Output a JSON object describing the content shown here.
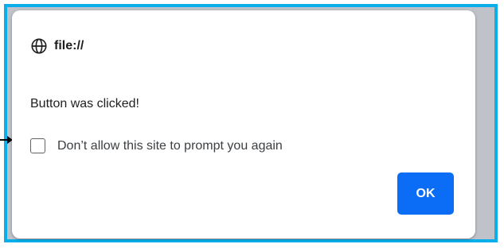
{
  "dialog": {
    "origin": "file://",
    "origin_icon": "globe-icon",
    "message": "Button was clicked!",
    "suppress_label": "Don’t allow this site to prompt you again",
    "suppress_checked": false,
    "ok_label": "OK"
  },
  "colors": {
    "frame_border": "#0aaeea",
    "ok_button": "#0b6cf6"
  }
}
